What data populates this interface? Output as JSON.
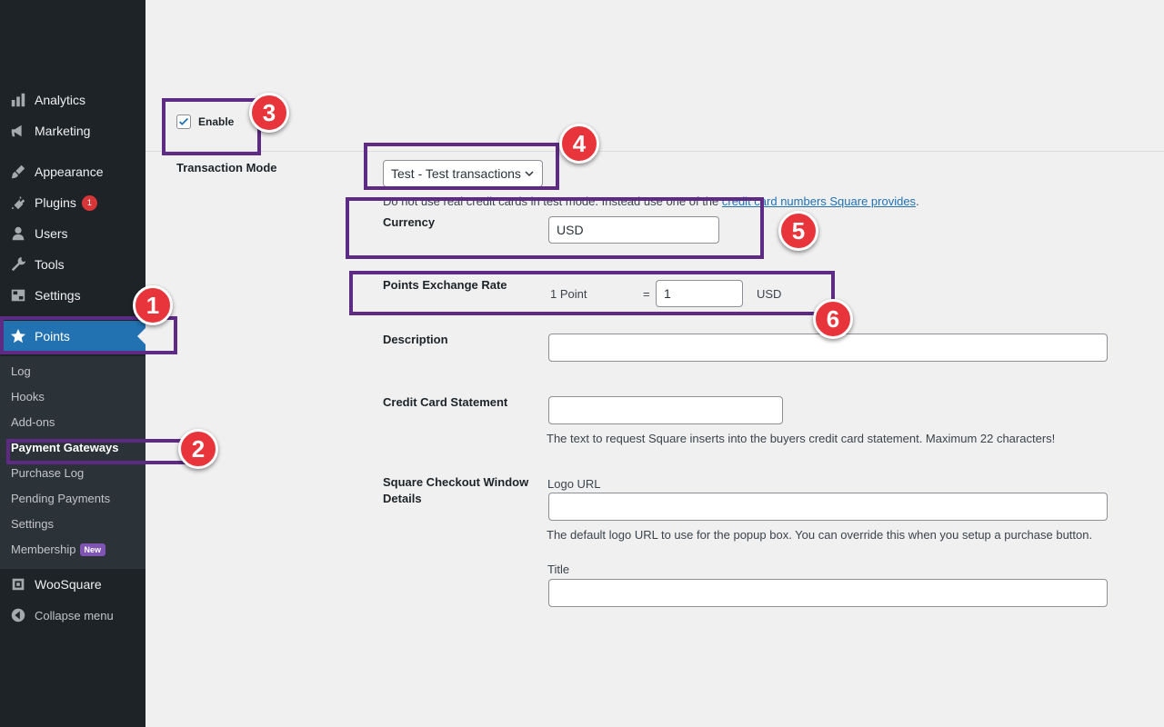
{
  "sidebar": {
    "menu": [
      {
        "label": "Analytics",
        "icon": "bar-chart-icon"
      },
      {
        "label": "Marketing",
        "icon": "megaphone-icon"
      },
      {
        "label": "Appearance",
        "icon": "paintbrush-icon"
      },
      {
        "label": "Plugins",
        "icon": "plugin-icon",
        "badge": "1"
      },
      {
        "label": "Users",
        "icon": "user-icon"
      },
      {
        "label": "Tools",
        "icon": "wrench-icon"
      },
      {
        "label": "Settings",
        "icon": "settings-icon"
      }
    ],
    "points": {
      "label": "Points",
      "icon": "star-icon"
    },
    "submenu": [
      {
        "label": "Log"
      },
      {
        "label": "Hooks"
      },
      {
        "label": "Add-ons"
      },
      {
        "label": "Payment Gateways"
      },
      {
        "label": "Purchase Log"
      },
      {
        "label": "Pending Payments"
      },
      {
        "label": "Settings"
      },
      {
        "label": "Membership",
        "badge": "New"
      }
    ],
    "woosquare": {
      "label": "WooSquare",
      "icon": "square-icon"
    },
    "collapse": {
      "label": "Collapse menu",
      "icon": "collapse-icon"
    }
  },
  "form": {
    "enable_label": "Enable",
    "enable_checked": true,
    "transaction_mode_label": "Transaction Mode",
    "transaction_mode_value": "Test - Test transactions",
    "test_notice_text": "Do not use real credit cards in test mode. Instead use one of the ",
    "test_notice_link": "credit card numbers Square provides",
    "test_notice_end": ".",
    "currency_label": "Currency",
    "currency_value": "USD",
    "exchange_label": "Points Exchange Rate",
    "exchange_point": "1 Point",
    "exchange_equals": "=",
    "exchange_value": "1",
    "exchange_unit": "USD",
    "description_label": "Description",
    "description_value": "",
    "statement_label": "Credit Card Statement",
    "statement_value": "",
    "statement_help": "The text to request Square inserts into the buyers credit card statement. Maximum 22 characters!",
    "checkout_label": "Square Checkout Window Details",
    "logo_url_label": "Logo URL",
    "logo_url_value": "",
    "logo_url_help": "The default logo URL to use for the popup box. You can override this when you setup a purchase button.",
    "title_label": "Title",
    "title_value": ""
  },
  "annotations": {
    "n1": "1",
    "n2": "2",
    "n3": "3",
    "n4": "4",
    "n5": "5",
    "n6": "6"
  },
  "colors": {
    "highlight": "#5d2a84",
    "callout": "#e8343b",
    "accent": "#2271b1",
    "sidebar_bg": "#1d2327"
  }
}
